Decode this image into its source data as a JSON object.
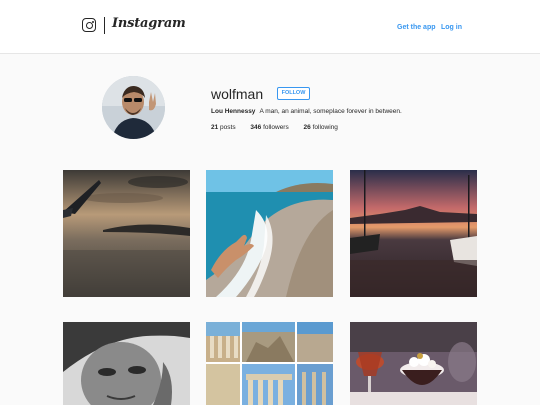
{
  "header": {
    "logo_text": "Instagram",
    "get_app_label": "Get the app",
    "login_label": "Log in"
  },
  "profile": {
    "username": "wolfman",
    "follow_label": "FOLLOW",
    "full_name": "Lou Hennessy",
    "bio": "A man, an animal, someplace forever in between.",
    "posts_count": "21",
    "posts_label": "posts",
    "followers_count": "346",
    "followers_label": "followers",
    "following_count": "26",
    "following_label": "following"
  },
  "colors": {
    "link_blue": "#3897f0",
    "text": "#262626",
    "background": "#fafafa"
  }
}
